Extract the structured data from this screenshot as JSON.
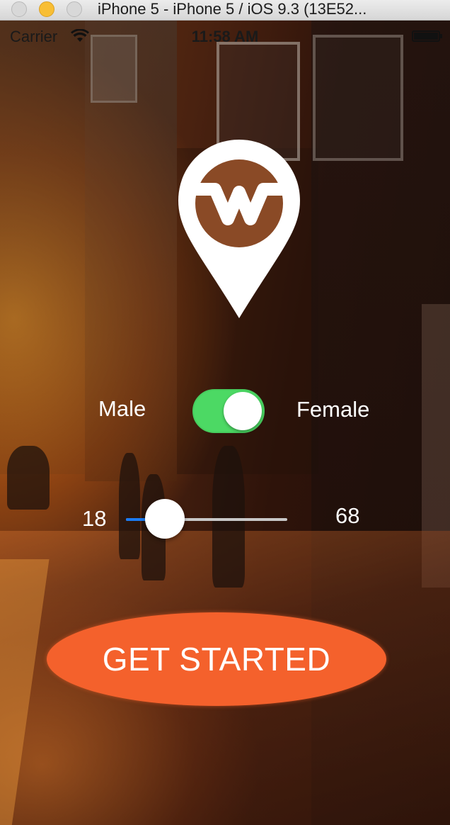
{
  "window": {
    "title": "iPhone 5 - iPhone 5 / iOS 9.3 (13E52..."
  },
  "status_bar": {
    "carrier": "Carrier",
    "time": "11:58 AM",
    "icons": [
      "wifi-icon",
      "battery-icon"
    ]
  },
  "logo": {
    "icon": "location-pin-w-logo-icon"
  },
  "gender": {
    "left_label": "Male",
    "right_label": "Female",
    "toggle_on": true,
    "on_color": "#4cd964"
  },
  "age": {
    "min_label": "18",
    "max_label": "68",
    "min": 18,
    "max": 68,
    "value": 30,
    "fill_color": "#1a7bf2"
  },
  "cta": {
    "label": "GET STARTED",
    "color": "#f4612c"
  }
}
